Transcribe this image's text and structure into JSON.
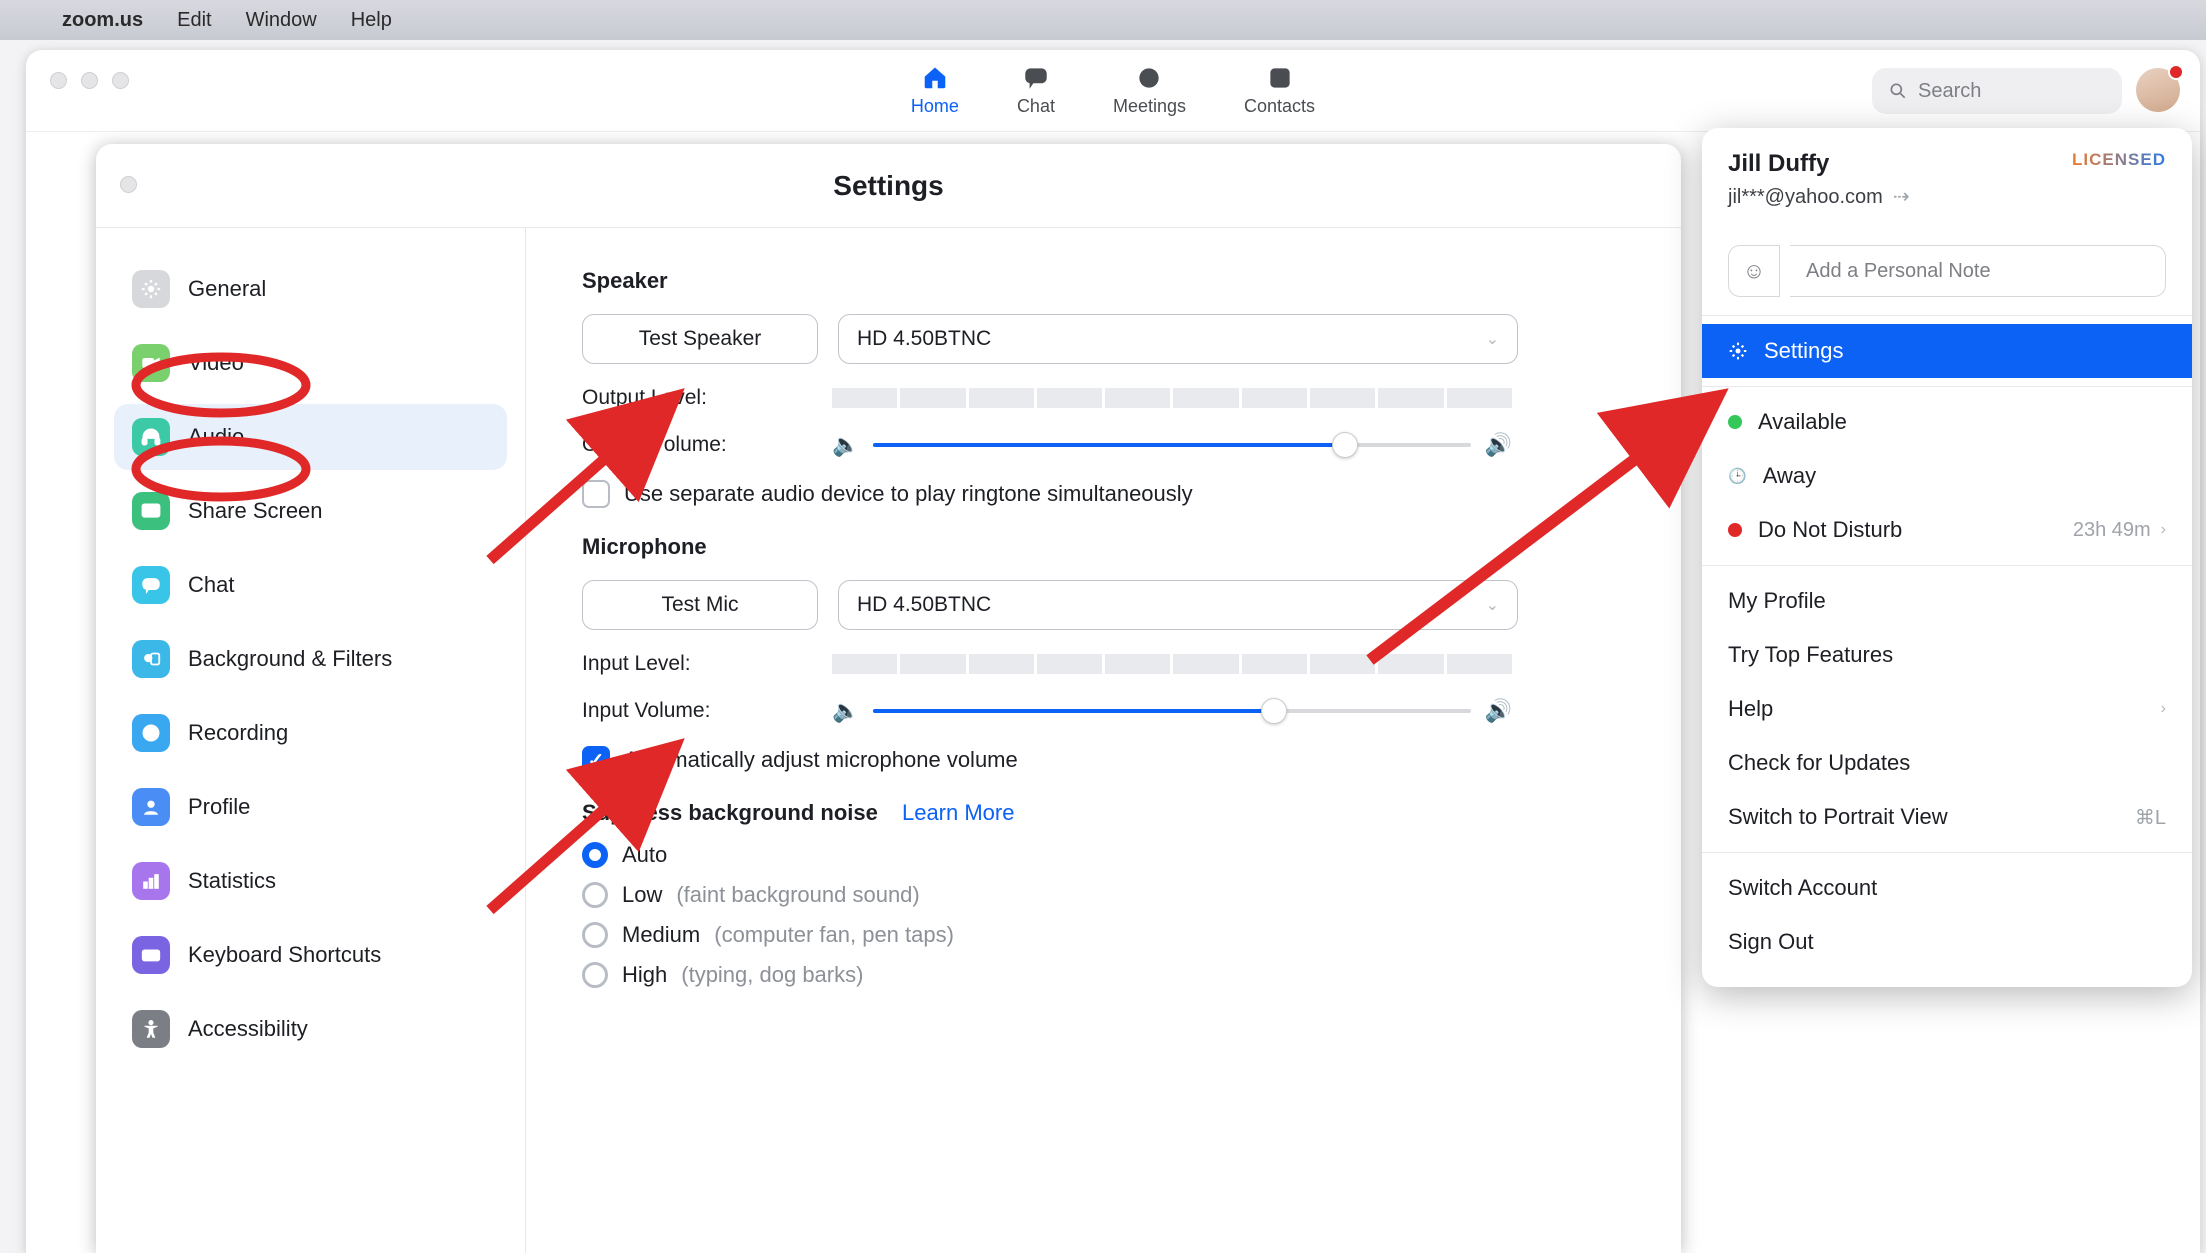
{
  "menubar": {
    "app_name": "zoom.us",
    "items": [
      "Edit",
      "Window",
      "Help"
    ]
  },
  "topnav": {
    "home": "Home",
    "chat": "Chat",
    "meetings": "Meetings",
    "contacts": "Contacts",
    "search_placeholder": "Search"
  },
  "settings": {
    "title": "Settings",
    "sidebar": {
      "general": "General",
      "video": "Video",
      "audio": "Audio",
      "share_screen": "Share Screen",
      "chat": "Chat",
      "bg_filters": "Background & Filters",
      "recording": "Recording",
      "profile": "Profile",
      "statistics": "Statistics",
      "kb_shortcuts": "Keyboard Shortcuts",
      "accessibility": "Accessibility"
    },
    "panel": {
      "speaker_title": "Speaker",
      "test_speaker": "Test Speaker",
      "speaker_device": "HD 4.50BTNC",
      "output_level": "Output Level:",
      "output_volume": "Output Volume:",
      "separate_ringtone": "Use separate audio device to play ringtone simultaneously",
      "mic_title": "Microphone",
      "test_mic": "Test Mic",
      "mic_device": "HD 4.50BTNC",
      "input_level": "Input Level:",
      "input_volume": "Input Volume:",
      "auto_adjust": "Automatically adjust microphone volume",
      "suppress_title": "Suppress background noise",
      "learn_more": "Learn More",
      "radio_auto": "Auto",
      "radio_low": "Low",
      "radio_low_hint": "(faint background sound)",
      "radio_med": "Medium",
      "radio_med_hint": "(computer fan, pen taps)",
      "radio_high": "High",
      "radio_high_hint": "(typing, dog barks)"
    }
  },
  "profile": {
    "name": "Jill Duffy",
    "license": "LICENSED",
    "email": "jil***@yahoo.com",
    "note_placeholder": "Add a Personal Note",
    "settings": "Settings",
    "available": "Available",
    "away": "Away",
    "dnd": "Do Not Disturb",
    "dnd_time": "23h 49m",
    "my_profile": "My Profile",
    "try_top": "Try Top Features",
    "help": "Help",
    "check_updates": "Check for Updates",
    "portrait": "Switch to Portrait View",
    "portrait_sc": "⌘L",
    "switch": "Switch Account",
    "sign_out": "Sign Out"
  },
  "colors": {
    "accent": "#0b62f5",
    "red": "#e02828"
  }
}
